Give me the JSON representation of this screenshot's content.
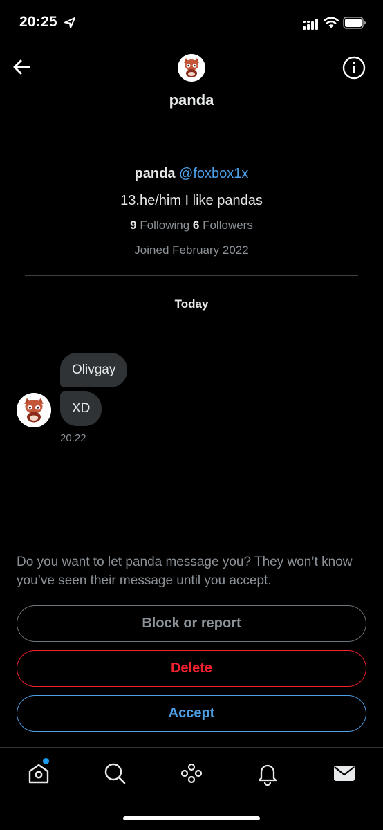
{
  "status_bar": {
    "time": "20:25",
    "icons": [
      "location-arrow-icon",
      "signal-icon",
      "wifi-icon",
      "battery-icon"
    ]
  },
  "header": {
    "title": "panda",
    "icons": [
      "back-arrow-icon",
      "avatar",
      "info-icon"
    ]
  },
  "profile": {
    "name": "panda",
    "handle": "@foxbox1x",
    "bio": "13.he/him I like pandas",
    "following_count": "9",
    "following_label": "Following",
    "followers_count": "6",
    "followers_label": "Followers",
    "joined": "Joined February 2022"
  },
  "conversation": {
    "date_label": "Today",
    "messages": [
      {
        "text": "Olivgay"
      },
      {
        "text": "XD"
      }
    ],
    "timestamp": "20:22"
  },
  "request": {
    "prompt": "Do you want to let panda message you? They won’t know you’ve seen their message until you accept.",
    "block_label": "Block or report",
    "delete_label": "Delete",
    "accept_label": "Accept"
  },
  "tab_bar": {
    "items": [
      "home-icon",
      "search-icon",
      "spaces-icon",
      "notifications-icon",
      "messages-icon"
    ],
    "active": "messages-icon"
  },
  "colors": {
    "background": "#000000",
    "bubble": "#2f3336",
    "link_blue": "#4d9fe6",
    "delete_red": "#f4212e",
    "muted_text": "#8b9298",
    "notification_dot": "#1d9bf0"
  }
}
